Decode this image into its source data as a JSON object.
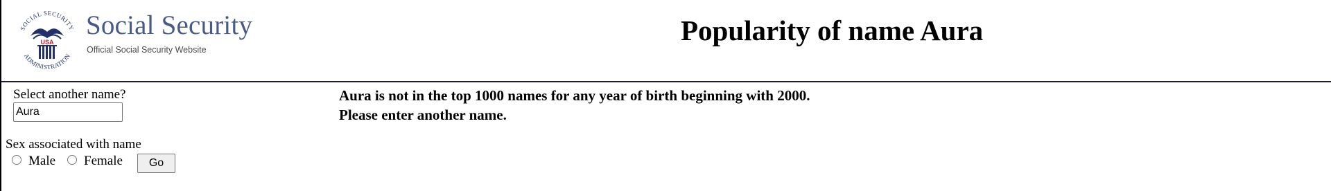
{
  "header": {
    "logo_text": "SOCIAL SECURITY ADMINISTRATION USA",
    "brand_name": "Social Security",
    "tagline": "Official Social Security Website",
    "page_title": "Popularity of name Aura"
  },
  "form": {
    "select_label": "Select another name?",
    "name_value": "Aura",
    "sex_label": "Sex associated with name",
    "male_label": "Male",
    "female_label": "Female",
    "go_label": "Go"
  },
  "result": {
    "line1": "Aura is not in the top 1000 names for any year of birth beginning with 2000.",
    "line2": "Please enter another name."
  },
  "colors": {
    "brand": "#4a5a86",
    "logo_red": "#c8202e",
    "logo_navy": "#23306a",
    "divider": "#1c1c3a"
  }
}
